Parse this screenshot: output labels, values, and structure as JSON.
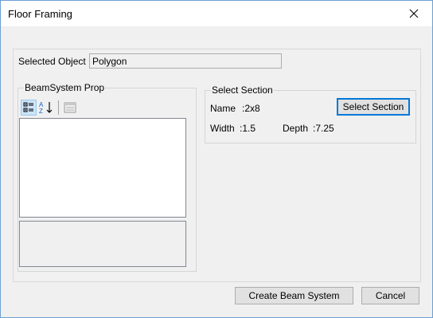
{
  "window": {
    "title": "Floor Framing",
    "close_icon": "close-icon"
  },
  "selected_object": {
    "label": "Selected Object",
    "value": "Polygon"
  },
  "beam_system_prop": {
    "title": "BeamSystem Prop",
    "toolbar": [
      "categorized-icon",
      "alphabetical-icon",
      "property-pages-icon"
    ]
  },
  "select_section": {
    "title": "Select Section",
    "name_label": "Name",
    "name_value": ":2x8",
    "width_label": "Width",
    "width_value": ":1.5",
    "depth_label": "Depth",
    "depth_value": ":7.25",
    "button_label": "Select Section"
  },
  "footer": {
    "create_label": "Create Beam System",
    "cancel_label": "Cancel"
  },
  "colors": {
    "accent": "#0078d7",
    "window_border": "#6d9fd1",
    "background": "#f0f0f0"
  }
}
